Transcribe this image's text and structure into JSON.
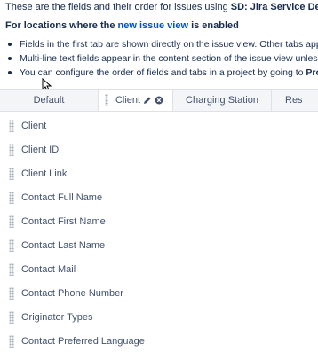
{
  "intro": {
    "prefix": "These are the fields and their order for issues using ",
    "project_type": "SD: Jira Service Desk: Major Incident"
  },
  "subheading": {
    "prefix": "For locations where the ",
    "link": "new issue view",
    "suffix": " is enabled"
  },
  "notes": [
    "Fields in the first tab are shown directly on the issue view. Other tabs appear as panels in",
    "Multi-line text fields appear in the content section of the issue view unless you place the",
    "You can configure the order of fields and tabs in a project by going to "
  ],
  "notes_bold_tail": "Project settings",
  "tabs": [
    {
      "label": "Default"
    },
    {
      "label": "Client"
    },
    {
      "label": "Charging Station"
    },
    {
      "label": "Res"
    }
  ],
  "fields": [
    "Client",
    "Client ID",
    "Client Link",
    "Contact Full Name",
    "Contact First Name",
    "Contact Last Name",
    "Contact Mail",
    "Contact Phone Number",
    "Originator Types",
    "Contact Preferred Language"
  ],
  "icons": {
    "edit": "pencil-icon",
    "close": "close-circle-icon",
    "grip": "drag-handle-icon",
    "cursor": "mouse-cursor-icon"
  },
  "colors": {
    "link": "#0052cc",
    "text": "#172b4d",
    "muted": "#42526e",
    "tab_bar": "#f4f5f7"
  }
}
